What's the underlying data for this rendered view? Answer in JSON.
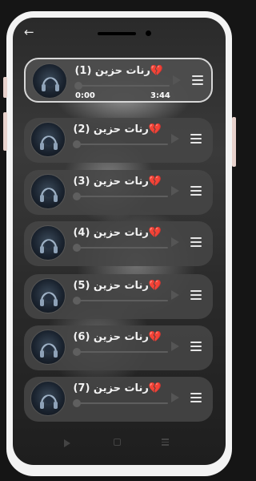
{
  "app": {
    "back_icon": "back-arrow-icon"
  },
  "tracks": [
    {
      "title": "💔رنات حزين (1)",
      "current_time": "0:00",
      "duration": "3:44",
      "active": true,
      "progress": 0
    },
    {
      "title": "💔رنات حزين (2)",
      "active": false,
      "progress": 0
    },
    {
      "title": "💔رنات حزين (3)",
      "active": false,
      "progress": 0
    },
    {
      "title": "💔رنات حزين (4)",
      "active": false,
      "progress": 0
    },
    {
      "title": "💔رنات حزين (5)",
      "active": false,
      "progress": 0
    },
    {
      "title": "💔رنات حزين (6)",
      "active": false,
      "progress": 0
    },
    {
      "title": "💔رنات حزين (7)",
      "active": false,
      "progress": 0
    }
  ],
  "system_nav": {
    "back": "nav-back-icon",
    "home": "nav-home-icon",
    "recents": "nav-recents-icon"
  }
}
